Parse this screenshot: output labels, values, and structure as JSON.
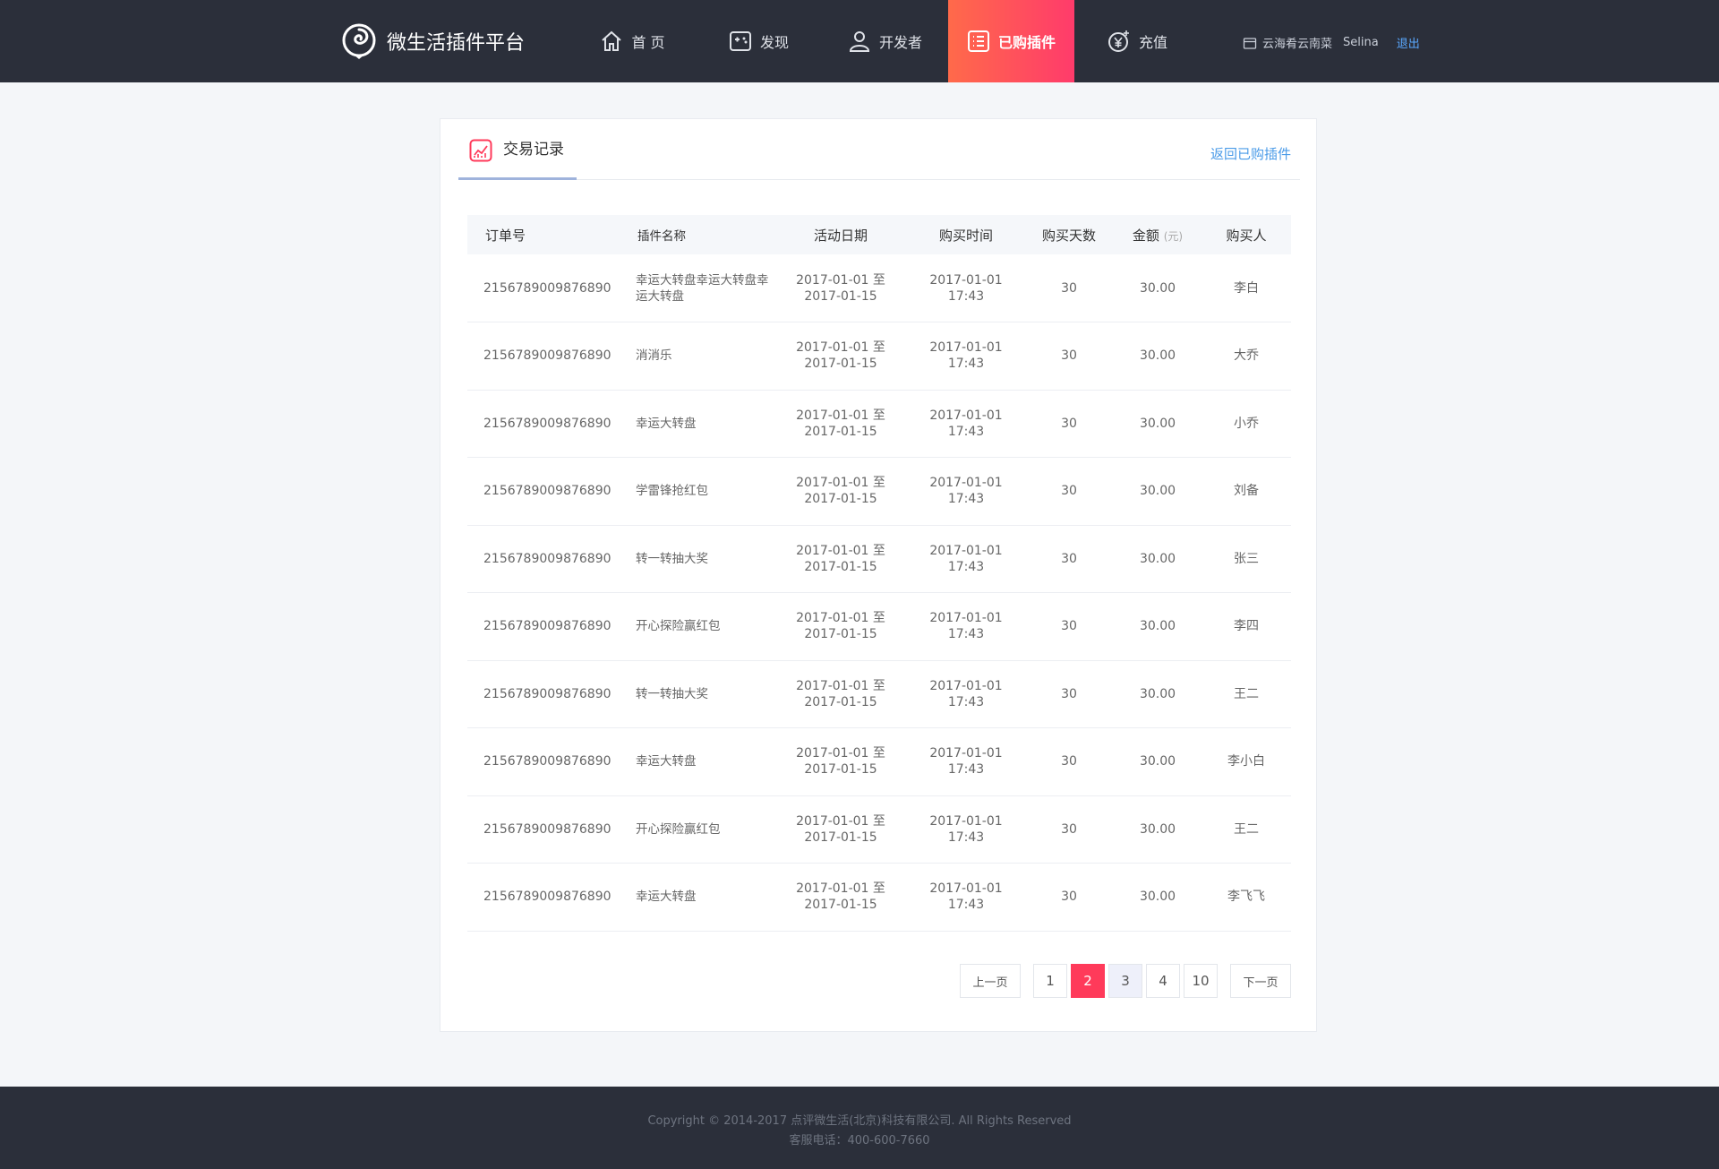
{
  "header": {
    "logo_text": "微生活插件平台",
    "nav": [
      {
        "label": "首 页",
        "icon": "home-icon"
      },
      {
        "label": "发现",
        "icon": "gamepad-icon"
      },
      {
        "label": "开发者",
        "icon": "user-icon"
      },
      {
        "label": "已购插件",
        "icon": "list-icon",
        "active": true
      },
      {
        "label": "充值",
        "icon": "yuan-icon"
      }
    ],
    "store": "云海肴云南菜",
    "username": "Selina",
    "logout": "退出"
  },
  "card": {
    "title": "交易记录",
    "back_link": "返回已购插件"
  },
  "table": {
    "headers": {
      "order": "订单号",
      "name": "插件名称",
      "date": "活动日期",
      "time": "购买时间",
      "days": "购买天数",
      "amount": "金额",
      "amount_unit": "(元)",
      "buyer": "购买人"
    },
    "rows": [
      {
        "order": "2156789009876890",
        "name": "幸运大转盘幸运大转盘幸运大转盘",
        "date1": "2017-01-01 至",
        "date2": "2017-01-15",
        "time1": "2017-01-01",
        "time2": "17:43",
        "days": "30",
        "amount": "30.00",
        "buyer": "李白"
      },
      {
        "order": "2156789009876890",
        "name": "消消乐",
        "date1": "2017-01-01 至",
        "date2": "2017-01-15",
        "time1": "2017-01-01",
        "time2": "17:43",
        "days": "30",
        "amount": "30.00",
        "buyer": "大乔"
      },
      {
        "order": "2156789009876890",
        "name": "幸运大转盘",
        "date1": "2017-01-01 至",
        "date2": "2017-01-15",
        "time1": "2017-01-01",
        "time2": "17:43",
        "days": "30",
        "amount": "30.00",
        "buyer": "小乔"
      },
      {
        "order": "2156789009876890",
        "name": "学雷锋抢红包",
        "date1": "2017-01-01 至",
        "date2": "2017-01-15",
        "time1": "2017-01-01",
        "time2": "17:43",
        "days": "30",
        "amount": "30.00",
        "buyer": "刘备"
      },
      {
        "order": "2156789009876890",
        "name": "转一转抽大奖",
        "date1": "2017-01-01 至",
        "date2": "2017-01-15",
        "time1": "2017-01-01",
        "time2": "17:43",
        "days": "30",
        "amount": "30.00",
        "buyer": "张三"
      },
      {
        "order": "2156789009876890",
        "name": "开心探险赢红包",
        "date1": "2017-01-01 至",
        "date2": "2017-01-15",
        "time1": "2017-01-01",
        "time2": "17:43",
        "days": "30",
        "amount": "30.00",
        "buyer": "李四"
      },
      {
        "order": "2156789009876890",
        "name": "转一转抽大奖",
        "date1": "2017-01-01 至",
        "date2": "2017-01-15",
        "time1": "2017-01-01",
        "time2": "17:43",
        "days": "30",
        "amount": "30.00",
        "buyer": "王二"
      },
      {
        "order": "2156789009876890",
        "name": "幸运大转盘",
        "date1": "2017-01-01 至",
        "date2": "2017-01-15",
        "time1": "2017-01-01",
        "time2": "17:43",
        "days": "30",
        "amount": "30.00",
        "buyer": "李小白"
      },
      {
        "order": "2156789009876890",
        "name": "开心探险赢红包",
        "date1": "2017-01-01 至",
        "date2": "2017-01-15",
        "time1": "2017-01-01",
        "time2": "17:43",
        "days": "30",
        "amount": "30.00",
        "buyer": "王二"
      },
      {
        "order": "2156789009876890",
        "name": "幸运大转盘",
        "date1": "2017-01-01 至",
        "date2": "2017-01-15",
        "time1": "2017-01-01",
        "time2": "17:43",
        "days": "30",
        "amount": "30.00",
        "buyer": "李飞飞"
      }
    ]
  },
  "pagination": {
    "prev": "上一页",
    "pages": [
      "1",
      "2",
      "3",
      "4",
      "10"
    ],
    "current": "2",
    "next": "下一页"
  },
  "footer": {
    "copyright": "Copyright © 2014-2017 点评微生活(北京)科技有限公司. All Rights Reserved",
    "phone": "客服电话：400-600-7660"
  },
  "colors": {
    "header_bg": "#2b2f3a",
    "accent": "#ff3a5a",
    "link": "#4a9be8"
  }
}
